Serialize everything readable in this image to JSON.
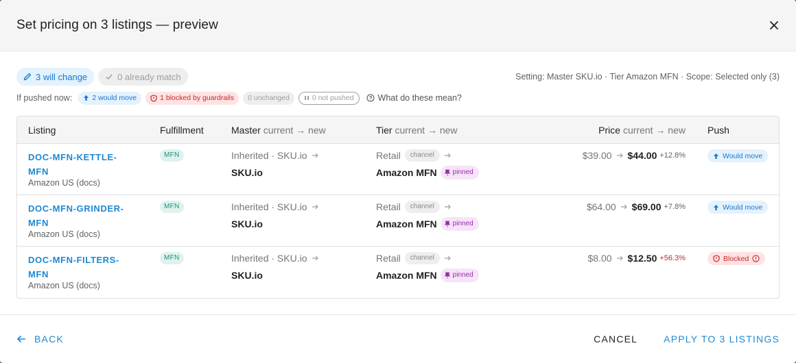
{
  "dialog": {
    "title": "Set pricing on 3 listings — preview",
    "close_icon": "close-icon"
  },
  "summary": {
    "will_change": "3 will change",
    "already_match": "0 already match",
    "setting": "Setting: Master SKU.io · Tier Amazon MFN · Scope: Selected only (3)"
  },
  "pushed_now": {
    "label": "If pushed now:",
    "would_move": "2 would move",
    "blocked": "1 blocked by guardrails",
    "unchanged": "0 unchanged",
    "not_pushed": "0 not pushed",
    "help": "What do these mean?"
  },
  "table": {
    "headers": {
      "listing": "Listing",
      "fulfillment": "Fulfillment",
      "master": "Master",
      "master_sub": "current → new",
      "tier": "Tier",
      "tier_sub": "current → new",
      "price": "Price",
      "price_sub": "current → new",
      "push": "Push"
    },
    "rows": [
      {
        "sku": "DOC-MFN-KETTLE-MFN",
        "store": "Amazon US (docs)",
        "fulfillment": "MFN",
        "master_current": "Inherited · SKU.io",
        "master_new": "SKU.io",
        "tier_current": "Retail",
        "tier_current_tag": "channel",
        "tier_new": "Amazon MFN",
        "tier_new_tag": "pinned",
        "price_current": "$39.00",
        "price_new": "$44.00",
        "price_delta": "+12.8%",
        "push": "Would move"
      },
      {
        "sku": "DOC-MFN-GRINDER-MFN",
        "store": "Amazon US (docs)",
        "fulfillment": "MFN",
        "master_current": "Inherited · SKU.io",
        "master_new": "SKU.io",
        "tier_current": "Retail",
        "tier_current_tag": "channel",
        "tier_new": "Amazon MFN",
        "tier_new_tag": "pinned",
        "price_current": "$64.00",
        "price_new": "$69.00",
        "price_delta": "+7.8%",
        "push": "Would move"
      },
      {
        "sku": "DOC-MFN-FILTERS-MFN",
        "store": "Amazon US (docs)",
        "fulfillment": "MFN",
        "master_current": "Inherited · SKU.io",
        "master_new": "SKU.io",
        "tier_current": "Retail",
        "tier_current_tag": "channel",
        "tier_new": "Amazon MFN",
        "tier_new_tag": "pinned",
        "price_current": "$8.00",
        "price_new": "$12.50",
        "price_delta": "+56.3%",
        "push": "Blocked"
      }
    ]
  },
  "footer": {
    "back": "Back",
    "cancel": "Cancel",
    "apply": "Apply to 3 listings"
  },
  "colors": {
    "accent": "#1e88d2",
    "blocked": "#c62828",
    "pinned": "#9c27b0",
    "mfn_badge": "#1a8f7e"
  }
}
